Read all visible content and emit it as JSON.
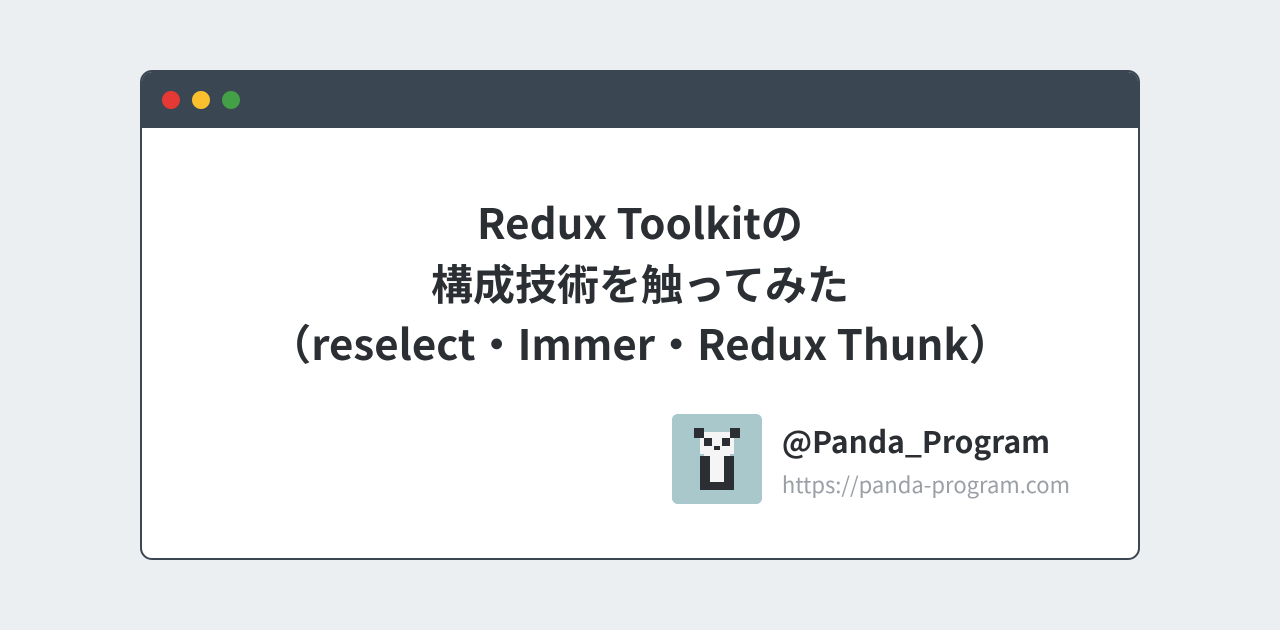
{
  "title": {
    "line1": "Redux Toolkitの",
    "line2": "構成技術を触ってみた",
    "line3": "（reselect・Immer・Redux Thunk）"
  },
  "author": {
    "handle": "@Panda_Program",
    "url": "https://panda-program.com"
  }
}
